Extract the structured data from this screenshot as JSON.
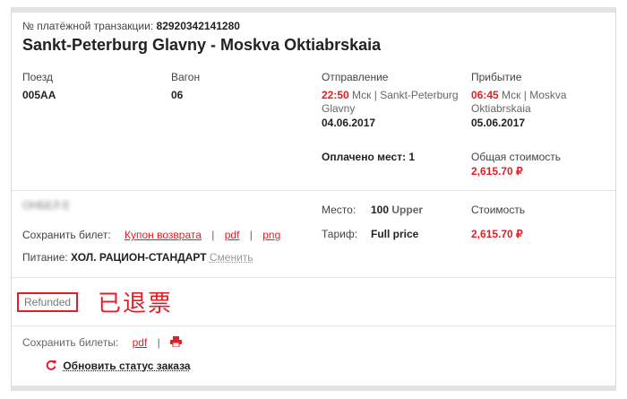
{
  "transaction": {
    "label": "№ платёжной транзакции:",
    "number": "82920342141280"
  },
  "route_title": "Sankt-Peterburg Glavny - Moskva Oktiabrskaia",
  "train": {
    "label": "Поезд",
    "value": "005АА"
  },
  "wagon": {
    "label": "Вагон",
    "value": "06"
  },
  "departure": {
    "label": "Отправление",
    "time": "22:50",
    "tz": "Мск | Sankt-Peterburg",
    "station2": "Glavny",
    "date": "04.06.2017"
  },
  "arrival": {
    "label": "Прибытие",
    "time": "06:45",
    "tz": "Мск | Moskva",
    "station2": "Oktiabrskaia",
    "date": "05.06.2017"
  },
  "paid_seats": "Оплачено мест: 1",
  "total": {
    "label": "Общая стоимость",
    "value": "2,615.70 ₽"
  },
  "passenger_blurred": "ОНБЕЛ Е",
  "ticket": {
    "save_label": "Сохранить билет:",
    "coupon": "Купон возврата",
    "sep1": "|",
    "pdf": "pdf",
    "sep2": "|",
    "png": "png"
  },
  "food": {
    "label": "Питание:",
    "value": "ХОЛ. РАЦИОН-СТАНДАРТ",
    "change": "Сменить"
  },
  "seat": {
    "label": "Место:",
    "number": "100",
    "type": "Upper"
  },
  "tariff": {
    "label": "Тариф:",
    "value": "Full price"
  },
  "cost": {
    "label": "Стоимость",
    "value": "2,615.70 ₽"
  },
  "status": {
    "badge": "Refunded",
    "annotation": "已退票"
  },
  "save_tickets": {
    "label": "Сохранить билеты:",
    "pdf": "pdf",
    "sep": "|"
  },
  "refresh": "Обновить статус заказа",
  "colors": {
    "accent": "#e31e24",
    "border": "#e3e3e3"
  }
}
